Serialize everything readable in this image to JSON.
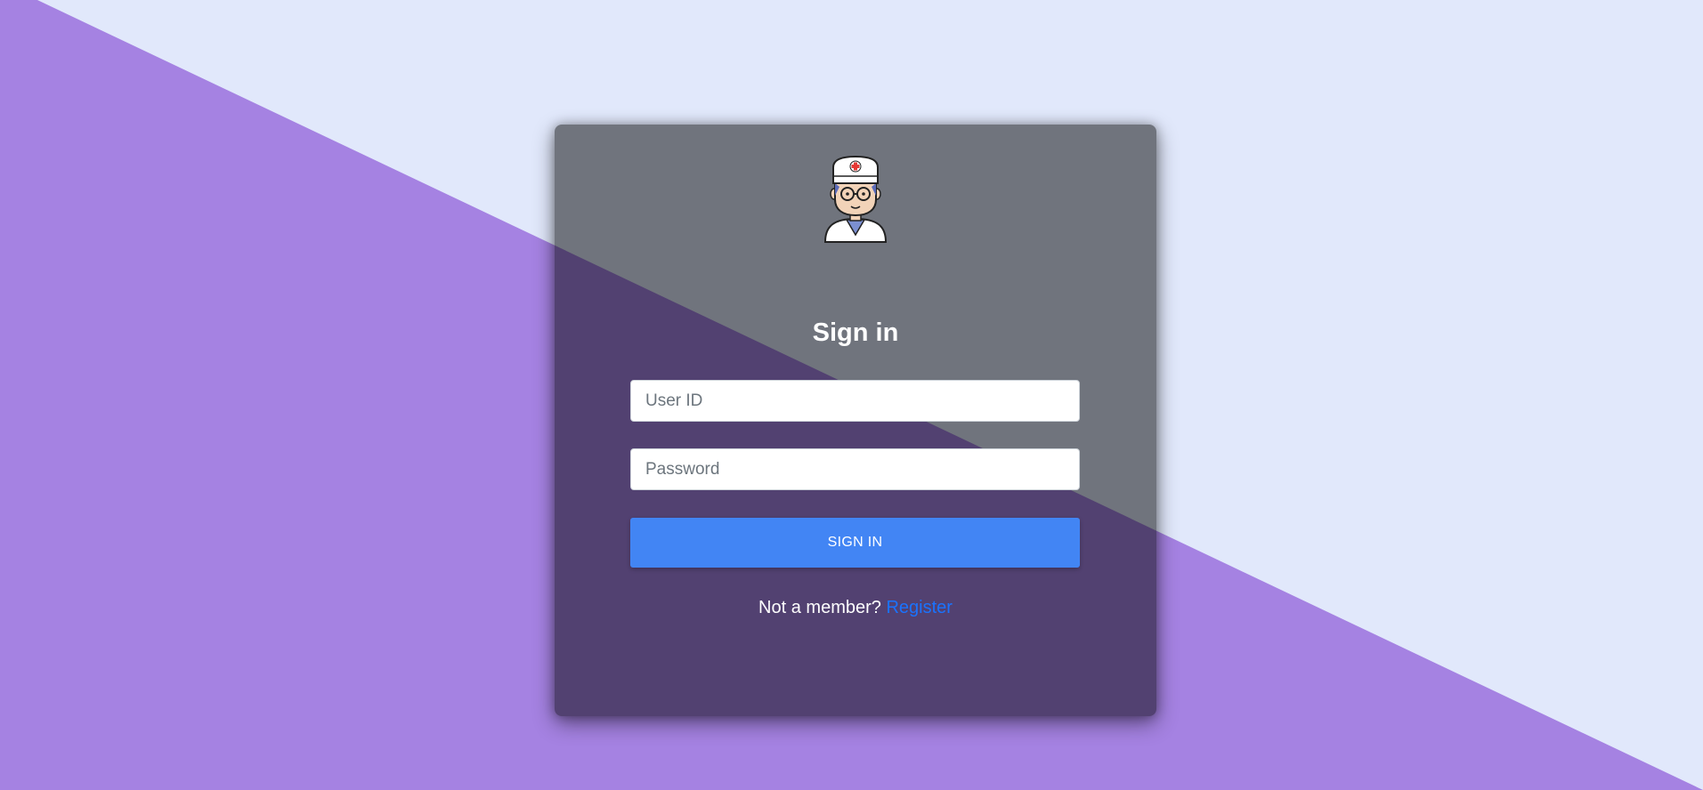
{
  "colors": {
    "background_light": "#e1e8fb",
    "background_purple": "#a582e2",
    "card_overlay": "rgba(0,0,0,0.5)",
    "button": "#4285f4",
    "link": "#1a73ff"
  },
  "avatar": {
    "icon": "doctor-avatar-icon"
  },
  "login": {
    "title": "Sign in",
    "userid_placeholder": "User ID",
    "userid_value": "",
    "password_placeholder": "Password",
    "password_value": "",
    "signin_label": "SIGN IN",
    "member_prompt": "Not a member?",
    "register_label": "Register"
  }
}
